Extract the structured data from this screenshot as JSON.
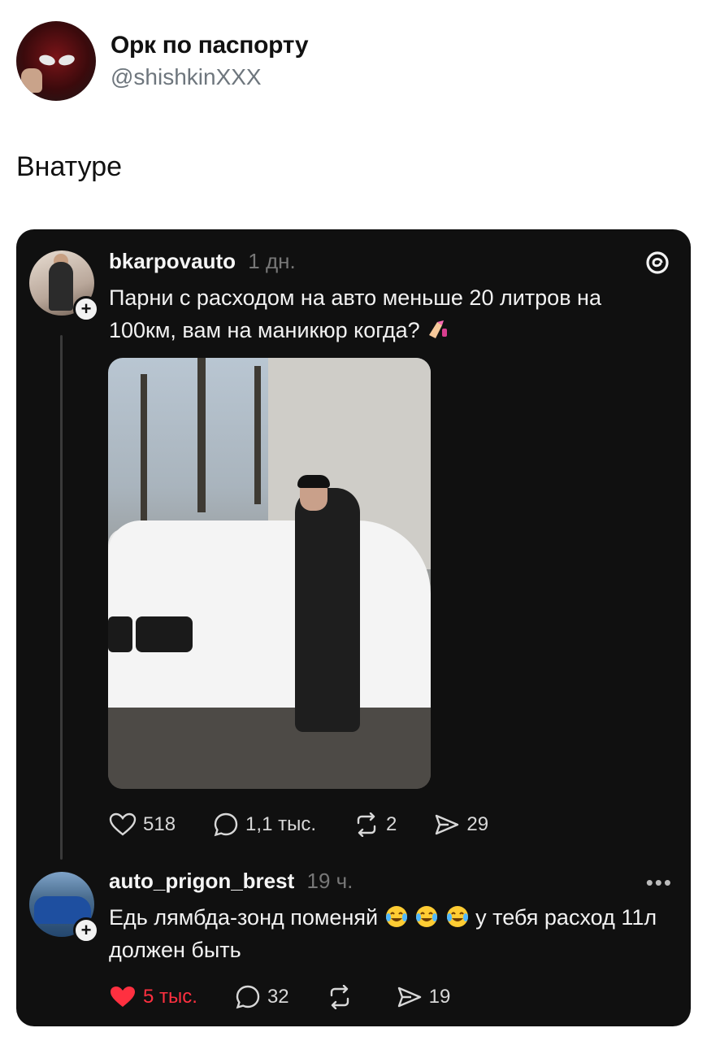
{
  "tweet": {
    "author_name": "Орк по паспорту",
    "author_handle": "@shishkinXXX",
    "text": "Внатуре"
  },
  "threads_post": {
    "username": "bkarpovauto",
    "time": "1 дн.",
    "text": "Парни с расходом на авто меньше 20 литров на 100км, вам на маникюр когда?",
    "emoji": "nail-polish",
    "likes": "518",
    "comments": "1,1 тыс.",
    "reposts": "2",
    "shares": "29"
  },
  "reply": {
    "username": "auto_prigon_brest",
    "time": "19 ч.",
    "text_before": "Едь лямбда-зонд поменяй",
    "emoji": "tears-of-joy x3",
    "text_after": "у тебя расход 11л должен быть",
    "likes": "5 тыс.",
    "comments": "32",
    "shares": "19",
    "liked_color": "#ff3040"
  },
  "threads_logo_label": "@"
}
